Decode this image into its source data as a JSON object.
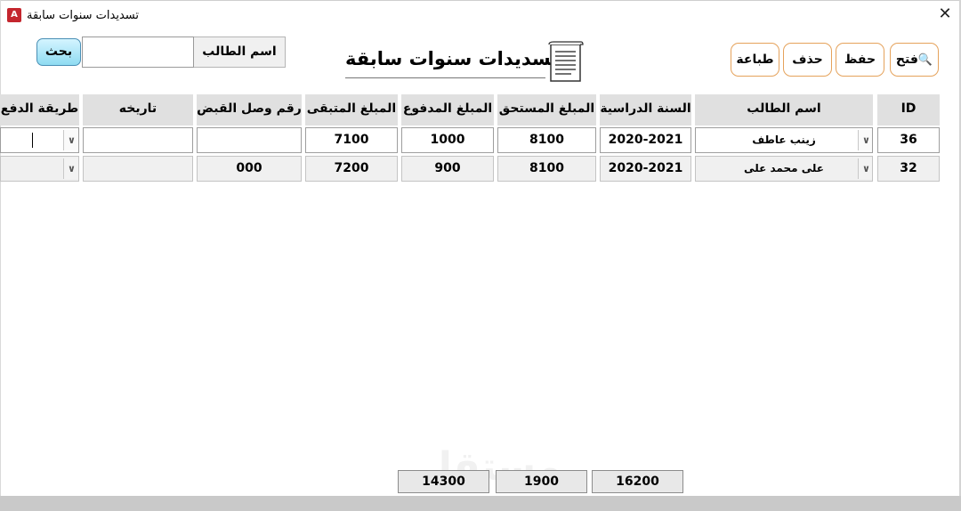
{
  "window": {
    "title": "تسديدات سنوات سابقة",
    "app_icon": "access-icon",
    "close_label": "✕"
  },
  "form": {
    "title": "تسديدات سنوات سابقة",
    "icon": "document-icon"
  },
  "search": {
    "label": "اسم الطالب",
    "value": "",
    "button": "بحث"
  },
  "actions": {
    "open": "فتح",
    "open_icon": "magnifier-icon",
    "save": "حفظ",
    "delete": "حذف",
    "print": "طباعة"
  },
  "table": {
    "headers": {
      "id": "ID",
      "student": "اسم الطالب",
      "year": "السنة الدراسية",
      "due": "المبلغ المستحق",
      "paid": "المبلغ المدفوع",
      "remaining": "المبلغ المتبقى",
      "receipt": "رقم وصل القبض",
      "date": "تاريخه",
      "method": "طريقة الدفع"
    },
    "rows": [
      {
        "id": "36",
        "student": "زينب عاطف",
        "year": "2020-2021",
        "due": "8100",
        "paid": "1000",
        "remaining": "7100",
        "receipt": "",
        "date": "",
        "method": ""
      },
      {
        "id": "32",
        "student": "على محمد على",
        "year": "2020-2021",
        "due": "8100",
        "paid": "900",
        "remaining": "7200",
        "receipt": "000",
        "date": "",
        "method": ""
      }
    ]
  },
  "totals": {
    "due": "16200",
    "paid": "1900",
    "remaining": "14300"
  },
  "watermark": "مستقل",
  "colors": {
    "accent_border": "#e5a25b",
    "search_button": "#8fdcf2",
    "header_bg": "#e0e0e0",
    "status_bar": "#c9c9c9"
  }
}
